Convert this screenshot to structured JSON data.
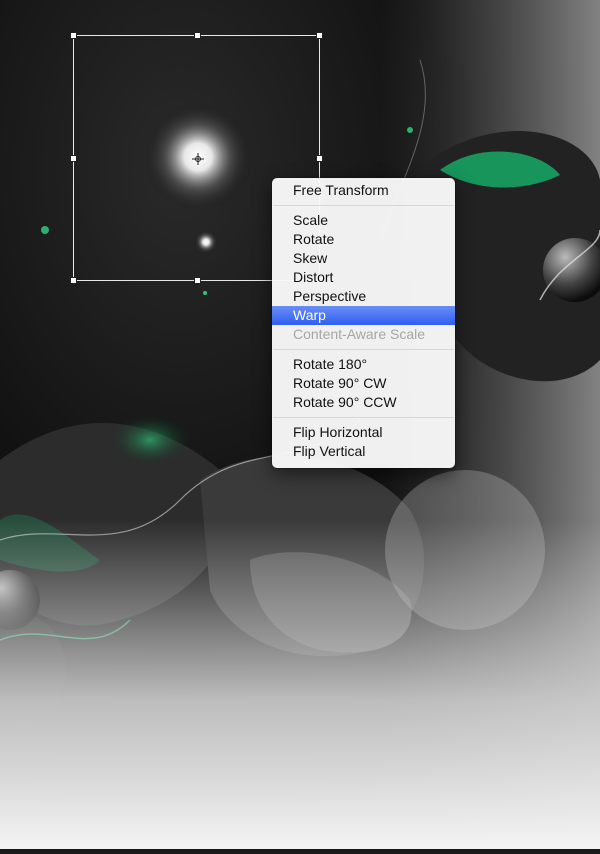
{
  "menu": {
    "groups": [
      [
        {
          "label": "Free Transform",
          "state": "normal"
        }
      ],
      [
        {
          "label": "Scale",
          "state": "normal"
        },
        {
          "label": "Rotate",
          "state": "normal"
        },
        {
          "label": "Skew",
          "state": "normal"
        },
        {
          "label": "Distort",
          "state": "normal"
        },
        {
          "label": "Perspective",
          "state": "normal"
        },
        {
          "label": "Warp",
          "state": "selected"
        },
        {
          "label": "Content-Aware Scale",
          "state": "disabled"
        }
      ],
      [
        {
          "label": "Rotate 180°",
          "state": "normal"
        },
        {
          "label": "Rotate 90° CW",
          "state": "normal"
        },
        {
          "label": "Rotate 90° CCW",
          "state": "normal"
        }
      ],
      [
        {
          "label": "Flip Horizontal",
          "state": "normal"
        },
        {
          "label": "Flip Vertical",
          "state": "normal"
        }
      ]
    ]
  },
  "colors": {
    "highlight": "#3b68f2",
    "accent_green": "#17b36a"
  }
}
